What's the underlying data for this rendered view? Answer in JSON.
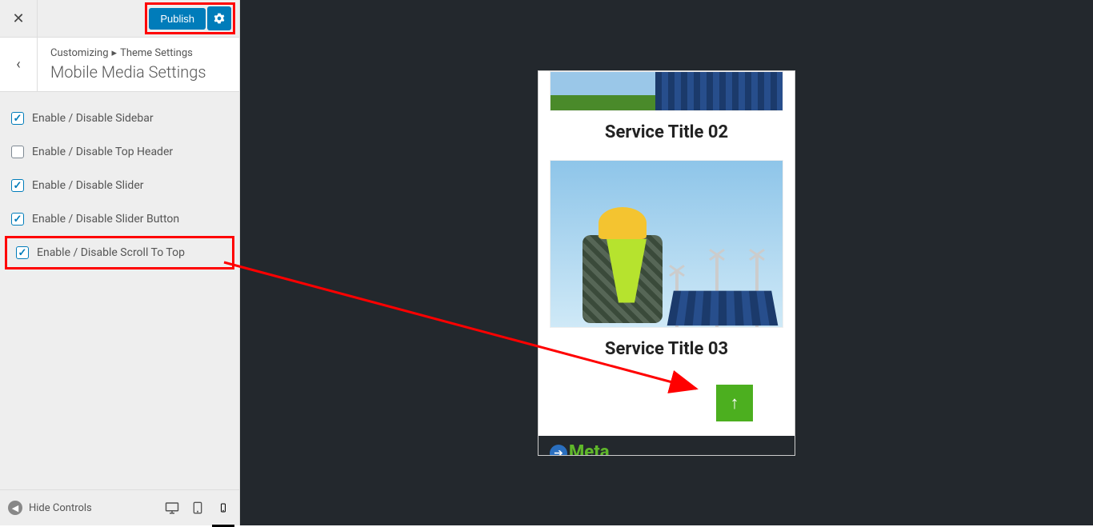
{
  "header": {
    "publish_label": "Publish"
  },
  "breadcrumb": {
    "root": "Customizing",
    "parent": "Theme Settings",
    "title": "Mobile Media Settings"
  },
  "options": [
    {
      "label": "Enable / Disable Sidebar",
      "checked": true
    },
    {
      "label": "Enable / Disable Top Header",
      "checked": false
    },
    {
      "label": "Enable / Disable Slider",
      "checked": true
    },
    {
      "label": "Enable / Disable Slider Button",
      "checked": true
    },
    {
      "label": "Enable / Disable Scroll To Top",
      "checked": true,
      "highlight": true
    }
  ],
  "footer": {
    "hide_controls_label": "Hide Controls"
  },
  "preview": {
    "service_title_2": "Service Title 02",
    "service_title_3": "Service Title 03",
    "meta_label": "Meta",
    "to_top_glyph": "↑"
  }
}
